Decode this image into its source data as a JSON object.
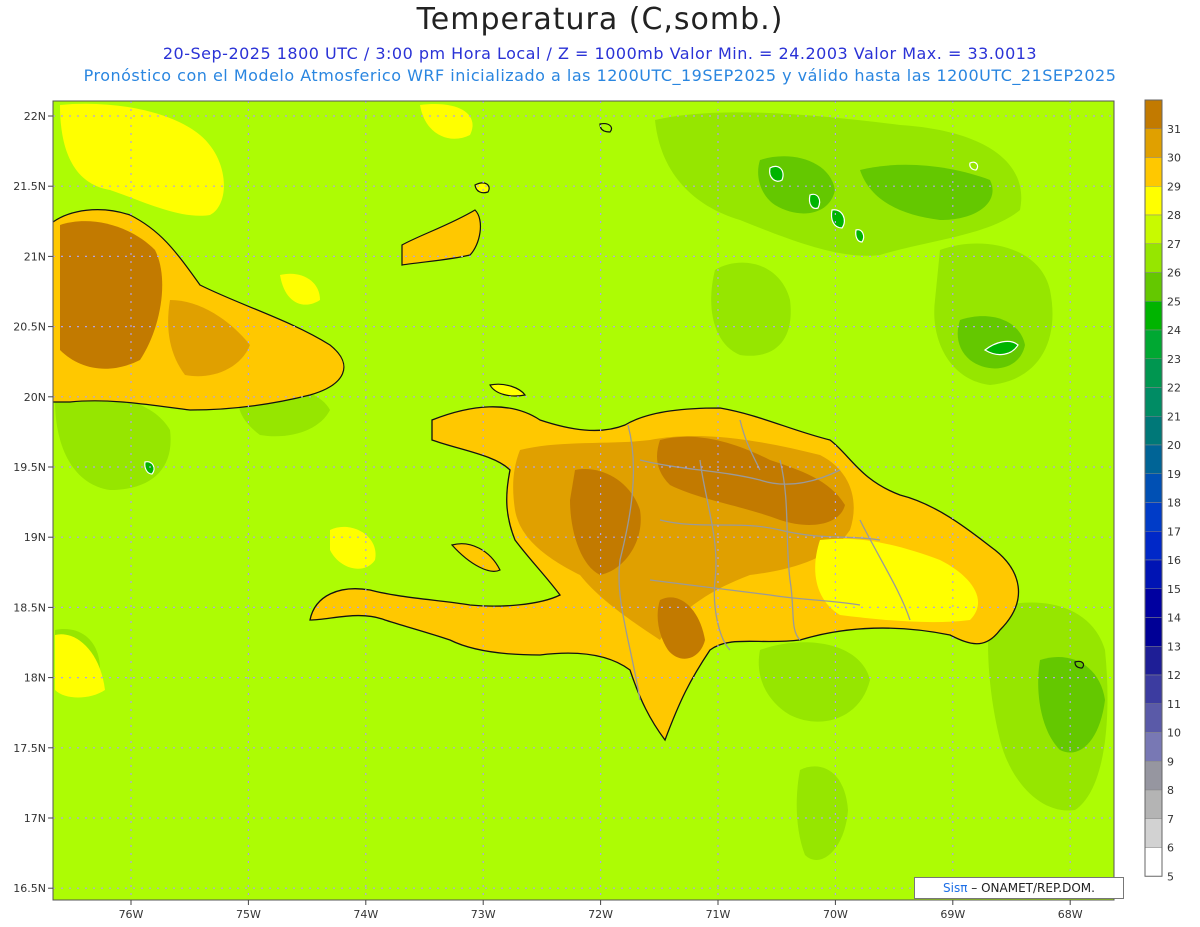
{
  "header": {
    "title": "Temperatura (C,somb.)",
    "subtitle_1": "20-Sep-2025  1800 UTC / 3:00 pm Hora Local / Z = 1000mb   Valor Min. = 24.2003  Valor Max. = 33.0013",
    "subtitle_2": "Pronóstico con el Modelo Atmosferico WRF inicializado a las 1200UTC_19SEP2025 y válido hasta las  1200UTC_21SEP2025"
  },
  "map": {
    "lon_range": [
      -76.6,
      -67.6
    ],
    "lat_range": [
      16.4,
      22.1
    ],
    "lat_labels": [
      "22N",
      "21.5N",
      "21N",
      "20.5N",
      "20N",
      "19.5N",
      "19N",
      "18.5N",
      "18N",
      "17.5N",
      "17N",
      "16.5N"
    ],
    "lon_labels": [
      "76W",
      "75W",
      "74W",
      "73W",
      "72W",
      "71W",
      "70W",
      "69W",
      "68W"
    ],
    "background_color": "#adfc04",
    "gridline_color": "#b0a0e8"
  },
  "colorbar": {
    "levels": [
      "31",
      "30",
      "29",
      "28",
      "27",
      "26",
      "25",
      "24",
      "23",
      "22",
      "21",
      "20",
      "19",
      "18",
      "17",
      "16",
      "15",
      "14",
      "13",
      "12",
      "11",
      "10",
      "9",
      "8",
      "7",
      "6",
      "5"
    ],
    "colors": [
      "#c27a00",
      "#e0a000",
      "#ffc800",
      "#ffff00",
      "#c8fa00",
      "#96e600",
      "#64c800",
      "#00b400",
      "#00a832",
      "#009650",
      "#008c64",
      "#007878",
      "#006496",
      "#0050b4",
      "#003cc8",
      "#0028c8",
      "#0014b4",
      "#0000a0",
      "#000096",
      "#1e1e96",
      "#3c3ca0",
      "#5a5aa8",
      "#7878b4",
      "#9696a0",
      "#b4b4b4",
      "#d2d2d2",
      "#ffffff"
    ]
  },
  "credit": {
    "brand": "Sisπ",
    "text": " – ONAMET/REP.DOM."
  }
}
